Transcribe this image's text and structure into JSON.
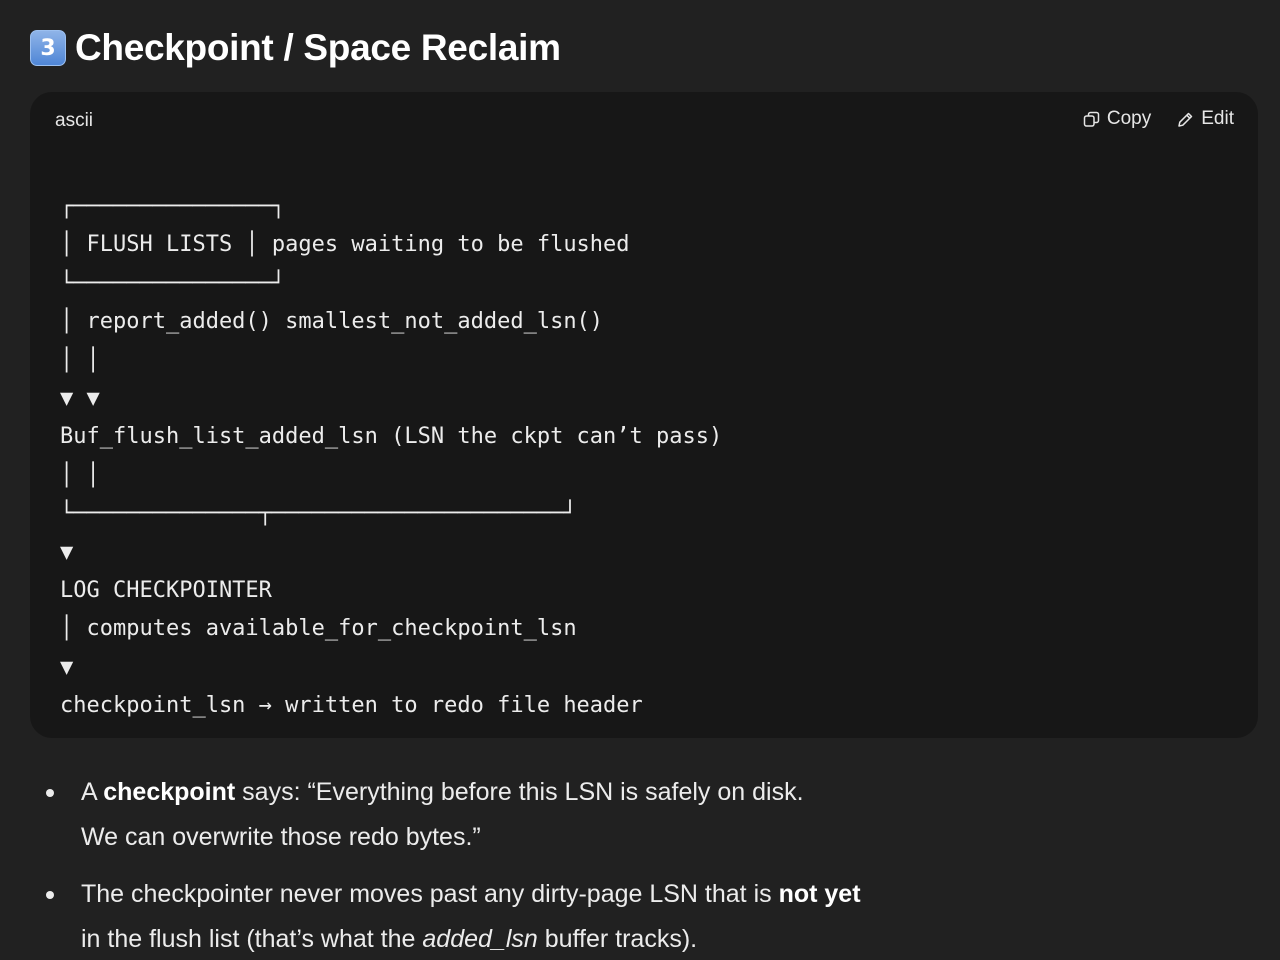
{
  "heading": {
    "badge": "3",
    "title": "Checkpoint / Space Reclaim"
  },
  "code_block": {
    "language": "ascii",
    "copy_label": "Copy",
    "edit_label": "Edit",
    "lines": [
      "┌───────────────┐",
      "│ FLUSH LISTS   │  pages waiting to be flushed",
      "└───────────────┘",
      "        │ report_added()             smallest_not_added_lsn()",
      "        │                                     │",
      "        ▼                                     ▼",
      " Buf_flush_list_added_lsn          (LSN the ckpt can’t pass)",
      "        │                                     │",
      "        └──────────────┬──────────────────────┘",
      "                       ▼",
      "                LOG CHECKPOINTER",
      "                       │ computes available_for_checkpoint_lsn",
      "                       ▼",
      "                checkpoint_lsn  →   written to redo file header"
    ]
  },
  "bullets": [
    {
      "line1_pre": "A ",
      "line1_bold": "checkpoint",
      "line1_post": " says: “Everything before this LSN is safely on disk.",
      "line2": "We can overwrite those redo bytes.”"
    },
    {
      "line1_pre": "The checkpointer never moves past any dirty-page LSN that is ",
      "line1_bold": "not yet",
      "line2_pre": "in the flush list (that’s what the ",
      "line2_italic": "added_lsn",
      "line2_post": " buffer tracks)."
    }
  ]
}
